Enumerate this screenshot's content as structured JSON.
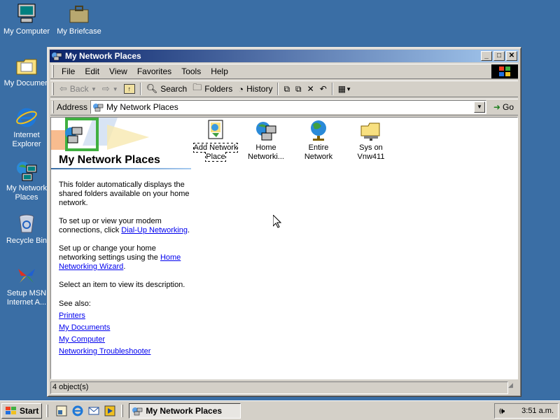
{
  "desktop": {
    "icons": [
      {
        "label": "My Computer",
        "icon": "computer-icon"
      },
      {
        "label": "My Briefcase",
        "icon": "briefcase-icon"
      },
      {
        "label": "My Documen",
        "icon": "folder-icon"
      },
      {
        "label": "Internet Explorer",
        "icon": "ie-icon"
      },
      {
        "label": "My Network Places",
        "icon": "network-icon"
      },
      {
        "label": "Recycle Bin",
        "icon": "recycle-bin-icon"
      },
      {
        "label": "Setup MSN Internet A...",
        "icon": "msn-butterfly-icon"
      }
    ]
  },
  "window": {
    "title": "My Network Places",
    "controls": {
      "minimize": "_",
      "maximize": "□",
      "close": "✕"
    },
    "menu": [
      "File",
      "Edit",
      "View",
      "Favorites",
      "Tools",
      "Help"
    ],
    "toolbar": {
      "back": "Back",
      "search": "Search",
      "folders": "Folders",
      "history": "History"
    },
    "address": {
      "label": "Address",
      "value": "My Network Places",
      "go": "Go"
    },
    "left_pane": {
      "title": "My Network Places",
      "description": "This folder automatically displays the shared folders available on your home network.",
      "modem_text": "To set up or view your modem connections, click",
      "modem_link": "Dial-Up Networking",
      "home_text": "Set up or change your home networking settings using the",
      "home_link": "Home Networking Wizard",
      "select_text": "Select an item to view its description.",
      "see_also": "See also:",
      "links": [
        "Printers",
        "My Documents",
        "My Computer",
        "Networking Troubleshooter"
      ]
    },
    "items": [
      {
        "label": "Add Network Place",
        "icon": "add-network-place-icon",
        "selected": true
      },
      {
        "label": "Home Networki...",
        "icon": "home-network-icon",
        "selected": false
      },
      {
        "label": "Entire Network",
        "icon": "globe-icon",
        "selected": false
      },
      {
        "label": "Sys on Vnw411",
        "icon": "shared-folder-icon",
        "selected": false
      }
    ],
    "status": "4 object(s)"
  },
  "taskbar": {
    "start": "Start",
    "task": "My Network Places",
    "clock": "3:51 a.m."
  }
}
